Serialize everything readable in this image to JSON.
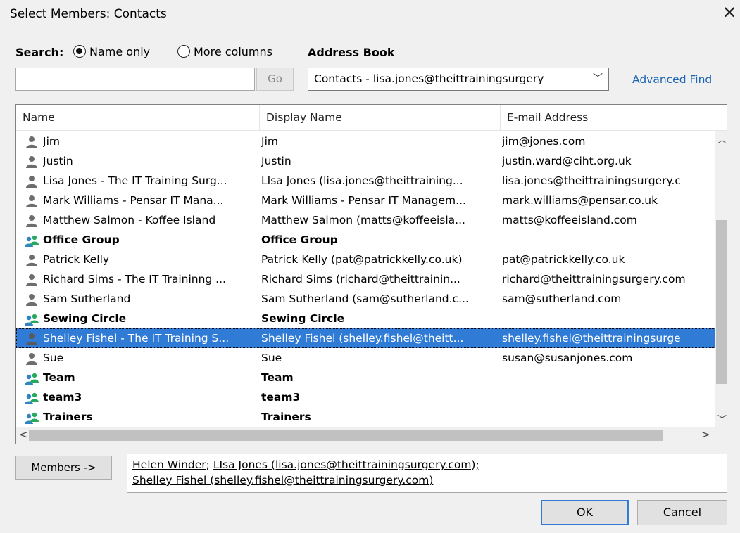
{
  "window": {
    "title": "Select Members: Contacts"
  },
  "search": {
    "label": "Search:",
    "option_name_only": "Name only",
    "option_more_columns": "More columns",
    "selected": "Name only",
    "input_value": "",
    "go_label": "Go"
  },
  "address_book": {
    "label": "Address Book",
    "selected": "Contacts - lisa.jones@theittrainingsurgery",
    "advanced_find": "Advanced Find"
  },
  "columns": [
    "Name",
    "Display Name",
    "E-mail Address"
  ],
  "rows": [
    {
      "type": "person",
      "name": "Jim",
      "display": "Jim",
      "email": "jim@jones.com"
    },
    {
      "type": "person",
      "name": "Justin",
      "display": "Justin",
      "email": "justin.ward@ciht.org.uk"
    },
    {
      "type": "person",
      "name": "Lisa Jones - The IT Training Surg...",
      "display": "LIsa Jones (lisa.jones@theittraining...",
      "email": "lisa.jones@theittrainingsurgery.c"
    },
    {
      "type": "person",
      "name": "Mark Williams - Pensar IT Mana...",
      "display": "Mark Williams - Pensar IT Managem...",
      "email": "mark.williams@pensar.co.uk"
    },
    {
      "type": "person",
      "name": "Matthew Salmon - Koffee Island",
      "display": "Matthew Salmon (matts@koffeeisla...",
      "email": "matts@koffeeisland.com"
    },
    {
      "type": "group",
      "name": "Office Group",
      "display": "Office Group",
      "email": ""
    },
    {
      "type": "person",
      "name": "Patrick Kelly",
      "display": "Patrick Kelly (pat@patrickkelly.co.uk)",
      "email": "pat@patrickkelly.co.uk"
    },
    {
      "type": "person",
      "name": "Richard Sims - The IT Traininng ...",
      "display": "Richard Sims (richard@theittrainin...",
      "email": "richard@theittrainingsurgery.com"
    },
    {
      "type": "person",
      "name": "Sam Sutherland",
      "display": "Sam Sutherland (sam@sutherland.c...",
      "email": "sam@sutherland.com"
    },
    {
      "type": "group",
      "name": "Sewing Circle",
      "display": "Sewing Circle",
      "email": ""
    },
    {
      "type": "person",
      "name": "Shelley Fishel - The IT Training S...",
      "display": "Shelley Fishel (shelley.fishel@theitt...",
      "email": "shelley.fishel@theittrainingsurge",
      "selected": true
    },
    {
      "type": "person",
      "name": "Sue",
      "display": "Sue",
      "email": "susan@susanjones.com"
    },
    {
      "type": "group",
      "name": "Team",
      "display": "Team",
      "email": ""
    },
    {
      "type": "group",
      "name": "team3",
      "display": "team3",
      "email": ""
    },
    {
      "type": "group",
      "name": "Trainers",
      "display": "Trainers",
      "email": ""
    }
  ],
  "members": {
    "button_label": "Members ->",
    "line1_a": "Helen Winder",
    "line1_sep": "; ",
    "line1_b": "LIsa Jones (lisa.jones@theittrainingsurgery.com);",
    "line2": "Shelley Fishel (shelley.fishel@theittrainingsurgery.com)"
  },
  "buttons": {
    "ok": "OK",
    "cancel": "Cancel"
  },
  "colors": {
    "selection": "#2f7bd6",
    "link": "#1a64b4",
    "group_icon_a": "#2e86c1",
    "group_icon_b": "#27a85f",
    "person_icon": "#6d6d6d"
  },
  "icons": {
    "person": "contact-person-icon",
    "group": "contact-group-icon"
  }
}
